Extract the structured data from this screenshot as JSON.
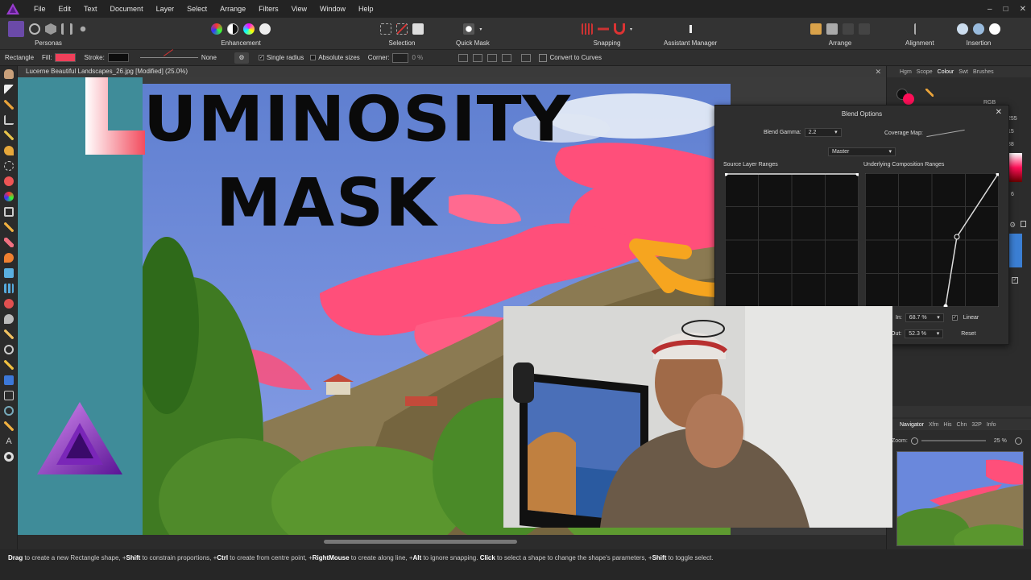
{
  "menubar": {
    "items": [
      "File",
      "Edit",
      "Text",
      "Document",
      "Layer",
      "Select",
      "Arrange",
      "Filters",
      "View",
      "Window",
      "Help"
    ],
    "controls": [
      "–",
      "□",
      "✕"
    ]
  },
  "toolbar": {
    "personas": "Personas",
    "enhancement": "Enhancement",
    "selection": "Selection",
    "quick_mask": "Quick Mask",
    "snapping": "Snapping",
    "assistant_manager": "Assistant Manager",
    "arrange": "Arrange",
    "alignment": "Alignment",
    "insertion": "Insertion"
  },
  "contextbar": {
    "tool_name": "Rectangle",
    "fill_label": "Fill:",
    "stroke_label": "Stroke:",
    "stroke_value": "None",
    "single_radius": "Single radius",
    "absolute_sizes": "Absolute sizes",
    "corner_label": "Corner:",
    "corner_value": "0 %",
    "convert_to_curves": "Convert to Curves",
    "fill_color": "#f0405a",
    "stroke_color": "#0d0d0d"
  },
  "document": {
    "tab_title": "Lucerne Beautiful Landscapes_26.jpg [Modified] (25.0%)",
    "close": "✕"
  },
  "overlay": {
    "line1": "UMINOSITY",
    "line2": "MASK",
    "big_letter": "L"
  },
  "right_panel": {
    "tabs": [
      "Hgm",
      "Scope",
      "Colour",
      "Swt",
      "Brushes"
    ],
    "active_tab": "Colour",
    "color_mode": "RGB",
    "values": [
      "255",
      "15",
      "88"
    ],
    "opacity_value": "6",
    "nav_tabs": [
      "Navigator",
      "Xfm",
      "His",
      "Chn",
      "32P",
      "Info"
    ],
    "nav_active": "Navigator",
    "zoom_label": "Zoom:",
    "zoom_value": "25 %"
  },
  "blend_options": {
    "title": "Blend Options",
    "close": "✕",
    "gamma_label": "Blend Gamma:",
    "gamma_value": "2.2",
    "coverage_label": "Coverage Map:",
    "channel": "Master",
    "source_label": "Source Layer Ranges",
    "underlying_label": "Underlying Composition Ranges",
    "in_label": "In:",
    "in_value": "68.7 %",
    "out_label": "Out:",
    "out_value": "52.3 %",
    "linear_label": "Linear",
    "reset_label": "Reset"
  },
  "statusbar": {
    "parts": [
      {
        "b": "Drag",
        "t": " to create a new Rectangle shape, +"
      },
      {
        "b": "Shift",
        "t": " to constrain proportions, +"
      },
      {
        "b": "Ctrl",
        "t": " to create from centre point, +"
      },
      {
        "b": "RightMouse",
        "t": " to create along line, +"
      },
      {
        "b": "Alt",
        "t": " to ignore snapping. "
      },
      {
        "b": "Click",
        "t": " to select a shape to change the shape's parameters, +"
      },
      {
        "b": "Shift",
        "t": " to toggle select."
      }
    ]
  },
  "colors": {
    "accent_pink": "#f0405a",
    "teal_bg": "#3f8c99",
    "arrow_orange": "#f6a51f",
    "affinity_purple": "#8e2fc0"
  }
}
